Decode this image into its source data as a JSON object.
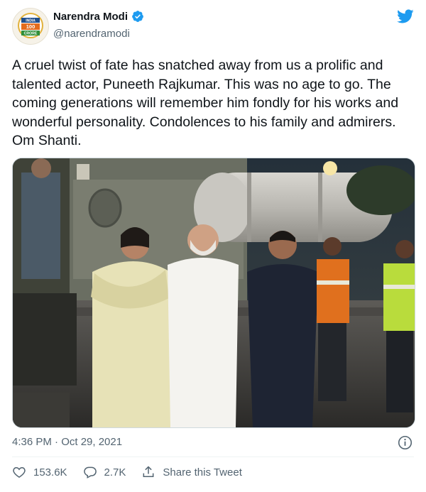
{
  "author": {
    "display_name": "Narendra Modi",
    "handle": "@narendramodi",
    "avatar_badge_line1": "INDIA",
    "avatar_badge_line2": "100",
    "avatar_badge_line3": "CRORE",
    "verified": true,
    "verified_color": "#1d9bf0"
  },
  "tweet": {
    "text": "A cruel twist of fate has snatched away from us a prolific and talented actor, Puneeth Rajkumar. This was no age to go. The coming generations will remember him fondly for his works and wonderful personality. Condolences to his family and admirers. Om Shanti.",
    "timestamp": "4:36 PM · Oct 29, 2021"
  },
  "actions": {
    "likes": "153.6K",
    "replies": "2.7K",
    "share_label": "Share this Tweet"
  },
  "icons": {
    "brand": "twitter-bird-icon",
    "verified": "verified-badge-icon",
    "info": "info-icon",
    "like": "heart-icon",
    "reply": "reply-icon",
    "share": "share-icon"
  },
  "colors": {
    "brand": "#1d9bf0",
    "secondary_text": "#536471",
    "primary_text": "#0f1419"
  }
}
